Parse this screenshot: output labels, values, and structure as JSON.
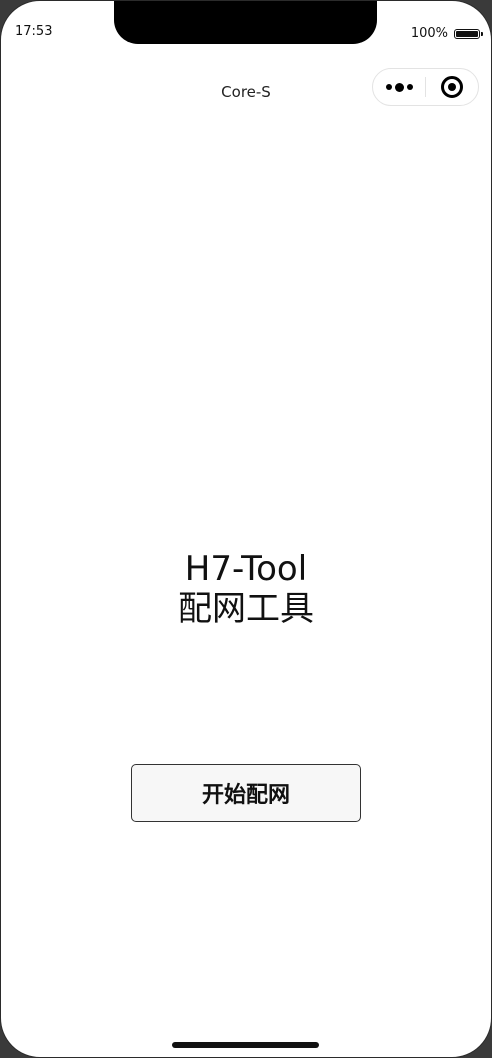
{
  "status_bar": {
    "time": "17:53",
    "battery_percent": "100%",
    "battery_level": 1.0
  },
  "nav_bar": {
    "title": "Core-S",
    "more_icon": "more-dots-icon",
    "close_icon": "target-circle-icon"
  },
  "main": {
    "title_line1": "H7-Tool",
    "title_line2": "配网工具",
    "start_button_label": "开始配网"
  },
  "colors": {
    "background": "#ffffff",
    "text": "#111111",
    "button_bg": "#f7f7f7",
    "button_border": "#333333"
  }
}
